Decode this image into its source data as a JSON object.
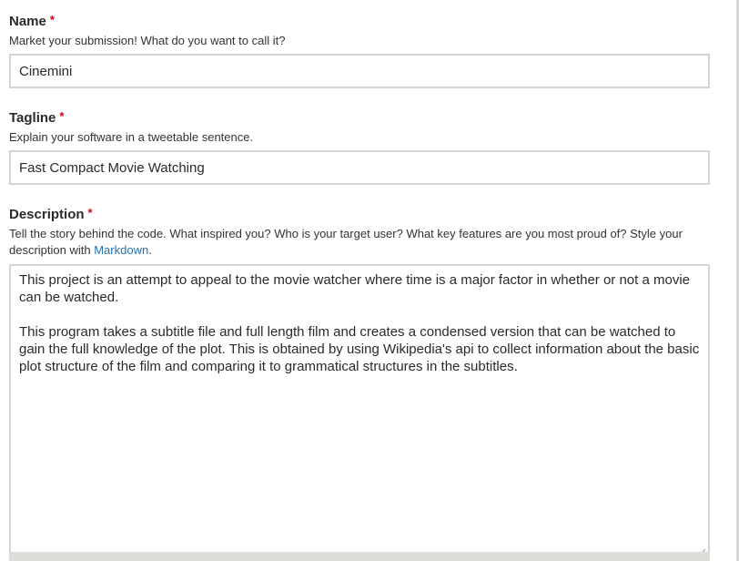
{
  "name_field": {
    "label": "Name",
    "required_mark": "*",
    "hint": "Market your submission! What do you want to call it?",
    "value": "Cinemini"
  },
  "tagline_field": {
    "label": "Tagline",
    "required_mark": "*",
    "hint": "Explain your software in a tweetable sentence.",
    "value": "Fast Compact Movie Watching"
  },
  "description_field": {
    "label": "Description",
    "required_mark": "*",
    "hint_prefix": "Tell the story behind the code. What inspired you? Who is your target user? What key features are you most proud of? Style your description with ",
    "hint_link": "Markdown",
    "hint_suffix": ".",
    "value": "This project is an attempt to appeal to the movie watcher where time is a major factor in whether or not a movie can be watched.\n\nThis program takes a subtitle file and full length film and creates a condensed version that can be watched to gain the full knowledge of the plot. This is obtained by using Wikipedia's api to collect information about the basic plot structure of the film and comparing it to grammatical structures in the subtitles."
  }
}
